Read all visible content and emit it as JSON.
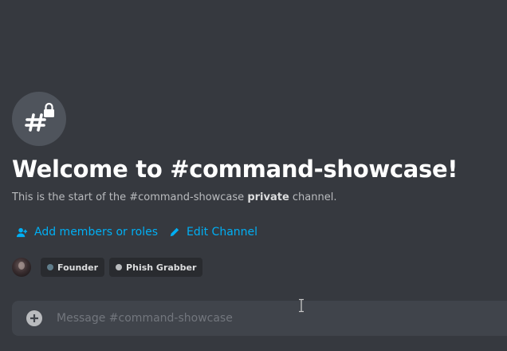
{
  "welcome": {
    "title": "Welcome to #command-showcase!",
    "subtitle_prefix": "This is the start of the #command-showcase ",
    "subtitle_bold": "private",
    "subtitle_suffix": " channel.",
    "channel_icon": "hashtag-lock-icon"
  },
  "actions": {
    "add_members": {
      "label": "Add members or roles",
      "icon": "person-icon"
    },
    "edit_channel": {
      "label": "Edit Channel",
      "icon": "pencil-icon"
    }
  },
  "members": {
    "avatar": "user-avatar",
    "roles": [
      {
        "name": "Founder",
        "color": "#607d8b"
      },
      {
        "name": "Phish Grabber",
        "color": "#b9bbbe"
      }
    ]
  },
  "composer": {
    "placeholder": "Message #command-showcase",
    "value": "",
    "attach_icon": "plus-circle-icon"
  },
  "colors": {
    "background": "#36393f",
    "link": "#00aff4",
    "composer_bg": "#40444b",
    "pill_bg": "#292b2f"
  }
}
